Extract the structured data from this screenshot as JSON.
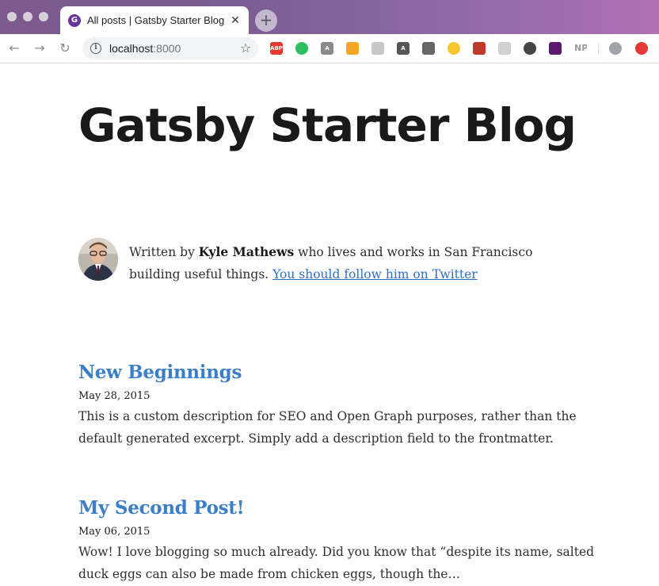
{
  "browser": {
    "tab_title": "All posts | Gatsby Starter Blog",
    "tab_close": "✕",
    "new_tab": "+",
    "url_host": "localhost",
    "url_port": ":8000",
    "nav": {
      "back": "←",
      "forward": "→",
      "reload": "↻"
    },
    "star": "☆",
    "extensions": [
      {
        "name": "adblock-plus-icon",
        "label": "ABP",
        "color": "#e23b2e"
      },
      {
        "name": "evernote-icon",
        "label": "",
        "color": "#2dbe60"
      },
      {
        "name": "angular-icon",
        "label": "A",
        "color": "#8a8a8a"
      },
      {
        "name": "rss-icon",
        "label": "",
        "color": "#f5a623"
      },
      {
        "name": "react-devtools-icon",
        "label": "",
        "color": "#c7c7c7"
      },
      {
        "name": "vue-devtools-icon",
        "label": "A",
        "color": "#555555"
      },
      {
        "name": "dark-mode-icon",
        "label": "",
        "color": "#666666"
      },
      {
        "name": "sun-icon",
        "label": "",
        "color": "#f7c52e"
      },
      {
        "name": "bug-icon",
        "label": "",
        "color": "#c0392b"
      },
      {
        "name": "gray-extension-icon",
        "label": "",
        "color": "#d0d0d0"
      },
      {
        "name": "circle-extension-icon",
        "label": "",
        "color": "#444444"
      },
      {
        "name": "purple-extension-icon",
        "label": "",
        "color": "#5b1a6e"
      },
      {
        "name": "np-extension-icon",
        "label": "NP",
        "color": "#9a9a9a"
      },
      {
        "name": "profile-avatar-icon",
        "label": "",
        "color": "#a0a4aa"
      },
      {
        "name": "upload-extension-icon",
        "label": "",
        "color": "#e53935"
      }
    ]
  },
  "page": {
    "site_title": "Gatsby Starter Blog",
    "bio": {
      "prefix": "Written by ",
      "author": "Kyle Mathews",
      "suffix": " who lives and works in San Francisco building useful things. ",
      "link_text": "You should follow him on Twitter"
    },
    "posts": [
      {
        "title": "New Beginnings",
        "date": "May 28, 2015",
        "excerpt": "This is a custom description for SEO and Open Graph purposes, rather than the default generated excerpt. Simply add a description field to the frontmatter."
      },
      {
        "title": "My Second Post!",
        "date": "May 06, 2015",
        "excerpt": "Wow! I love blogging so much already. Did you know that “despite its name, salted duck eggs can also be made from chicken eggs, though the…"
      }
    ]
  },
  "colors": {
    "link": "#2f6fc4",
    "post_title": "#3a7fc8",
    "title_text": "#1a1a1a"
  }
}
